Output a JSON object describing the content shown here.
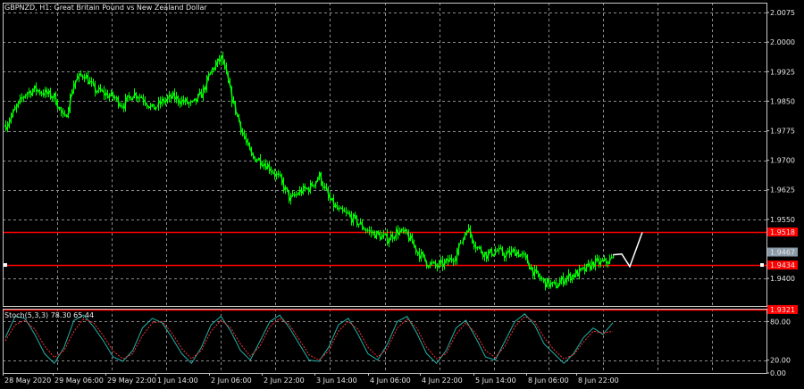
{
  "window": {
    "title": "GBPNZD, H1:  Great Britain Pound vs New Zealand Dollar"
  },
  "colors": {
    "background": "#000000",
    "frame": "#c8c8c8",
    "grid": "#8b8b8b",
    "text": "#e6e6e6",
    "bull_candle": "#00ff00",
    "bear_candle": "#00ff00",
    "projection": "#ffffff",
    "level_line": "#ff0000",
    "bid_tag": "#8a9aa8",
    "stoch_main": "#20b2aa",
    "stoch_signal": "#ff3030"
  },
  "chart_data": [
    {
      "type": "candlestick",
      "symbol": "GBPNZD",
      "timeframe": "H1",
      "ylim": [
        1.933,
        2.01
      ],
      "y_ticks": [
        "2.0075",
        "2.0000",
        "1.9925",
        "1.9850",
        "1.9775",
        "1.9700",
        "1.9625",
        "1.9550",
        "1.9400"
      ],
      "x_ticks": [
        "28 May 2020",
        "29 May 06:00",
        "29 May 22:00",
        "1 Jun 14:00",
        "2 Jun 06:00",
        "2 Jun 22:00",
        "3 Jun 14:00",
        "4 Jun 06:00",
        "4 Jun 22:00",
        "5 Jun 14:00",
        "8 Jun 06:00",
        "8 Jun 22:00"
      ],
      "close_path": [
        1.979,
        1.983,
        1.987,
        1.988,
        1.987,
        1.986,
        1.98,
        1.99,
        1.992,
        1.988,
        1.987,
        1.986,
        1.984,
        1.987,
        1.986,
        1.983,
        1.985,
        1.986,
        1.985,
        1.984,
        1.987,
        1.993,
        1.996,
        1.986,
        1.978,
        1.971,
        1.97,
        1.968,
        1.965,
        1.96,
        1.962,
        1.963,
        1.966,
        1.96,
        1.957,
        1.956,
        1.954,
        1.952,
        1.951,
        1.95,
        1.952,
        1.951,
        1.947,
        1.944,
        1.943,
        1.944,
        1.946,
        1.953,
        1.948,
        1.946,
        1.947,
        1.946,
        1.947,
        1.945,
        1.941,
        1.939,
        1.938,
        1.94,
        1.941,
        1.942,
        1.944,
        1.944,
        1.945
      ],
      "projection": [
        {
          "x": 1.94,
          "y": 1.946
        },
        {
          "x": 1.942,
          "y": 1.948
        },
        {
          "x": 1.946,
          "y": 1.953
        }
      ],
      "levels": [
        {
          "value": 1.9518,
          "label": "1.9518",
          "color": "#ff0000"
        },
        {
          "value": 1.9434,
          "label": "1.9434",
          "color": "#ff0000"
        },
        {
          "value": 1.9321,
          "label": "1.9321",
          "color": "#ff0000"
        }
      ],
      "bid": {
        "value": 1.9467,
        "label": "1.9467"
      }
    },
    {
      "type": "line",
      "title": "Stoch(5,3,3) 78.30 65.44",
      "ylim": [
        0,
        100
      ],
      "y_ticks": [
        "100.00",
        "80.00",
        "20.00",
        "0.00"
      ],
      "levels": [
        80,
        20
      ],
      "series": [
        {
          "name": "main",
          "values": [
            55,
            88,
            85,
            60,
            30,
            15,
            40,
            82,
            90,
            72,
            50,
            25,
            18,
            35,
            70,
            85,
            78,
            55,
            30,
            15,
            40,
            75,
            88,
            65,
            35,
            20,
            50,
            80,
            90,
            70,
            45,
            20,
            18,
            40,
            75,
            85,
            60,
            30,
            20,
            45,
            80,
            88,
            62,
            30,
            15,
            35,
            70,
            82,
            55,
            25,
            20,
            50,
            80,
            92,
            75,
            45,
            30,
            15,
            30,
            55,
            70,
            60,
            78
          ]
        },
        {
          "name": "signal",
          "values": [
            50,
            75,
            82,
            68,
            42,
            24,
            35,
            65,
            84,
            78,
            58,
            34,
            22,
            30,
            58,
            78,
            80,
            62,
            38,
            22,
            35,
            65,
            82,
            70,
            45,
            26,
            42,
            72,
            85,
            75,
            52,
            28,
            20,
            34,
            65,
            80,
            68,
            40,
            25,
            38,
            70,
            84,
            70,
            40,
            22,
            30,
            60,
            78,
            62,
            35,
            24,
            42,
            72,
            88,
            80,
            55,
            36,
            22,
            28,
            48,
            65,
            62,
            65
          ]
        }
      ]
    }
  ]
}
